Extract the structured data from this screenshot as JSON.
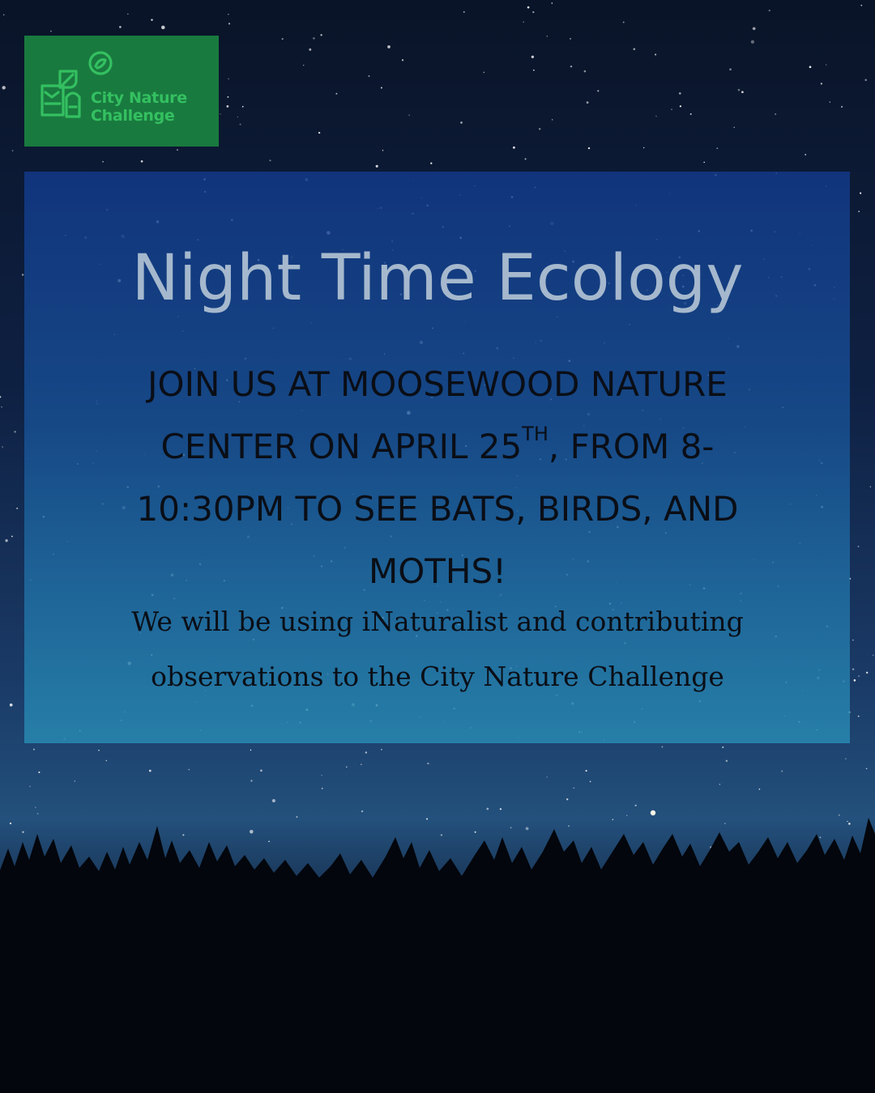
{
  "logo": {
    "line1": "City Nature",
    "line2": "Challenge",
    "colors": {
      "background": "#197a3f",
      "mark": "#34c061"
    }
  },
  "event": {
    "title": "Night Time Ecology",
    "announcement": {
      "line1": "JOIN US AT MOOSEWOOD NATURE",
      "line2_before": "CENTER ON APRIL 25",
      "line2_sup": "TH",
      "line2_after": ", FROM 8-",
      "line3": "10:30PM TO SEE BATS, BIRDS, AND",
      "line4": "MOTHS!"
    },
    "note": {
      "line1": "We will be using iNaturalist and contributing",
      "line2": "observations to the City Nature Challenge"
    }
  },
  "colors": {
    "sky_dark": "#0a1428",
    "panel": "#1a5a9a",
    "title_text": "#a5b8cd",
    "body_text": "#0a0e16",
    "trees": "#03060c"
  }
}
